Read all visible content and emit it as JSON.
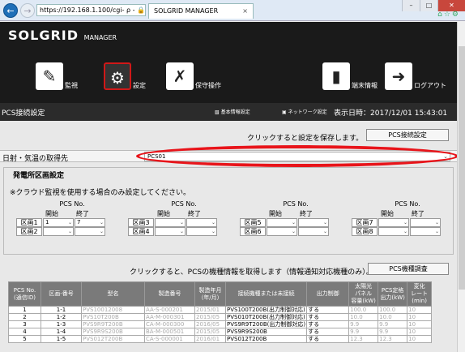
{
  "browser": {
    "url": "https://192.168.1.100/cgi- ρ - 🔒 C",
    "tab_title": "SOLGRID MANAGER",
    "tab_close": "×",
    "controls": {
      "min": "–",
      "max": "□",
      "close": "✕"
    }
  },
  "header": {
    "logo": "SOLGRID",
    "logo_sub": "MANAGER",
    "nav": {
      "monitor": "監視",
      "settings": "設定",
      "maintenance": "保守操作",
      "terminal_info": "端末情報",
      "logout": "ログアウト"
    }
  },
  "subheader": {
    "page_title": "PCS接続設定",
    "basic_settings": "基本情報設定",
    "network_settings": "ネットワーク設定",
    "datetime_label": "表示日時：2017/12/01 15:43:01"
  },
  "save": {
    "note": "クリックすると設定を保存します。",
    "button": "PCS接続設定"
  },
  "source": {
    "label": "日射・気温の取得先",
    "value": "PCS01"
  },
  "area": {
    "title": "発電所区画設定",
    "note": "※クラウド監視を使用する場合のみ設定してください。",
    "pcs_no": "PCS No.",
    "start": "開始",
    "end": "終了",
    "groups": [
      {
        "rows": [
          {
            "label": "区画1",
            "start": "1",
            "end": "7"
          },
          {
            "label": "区画2",
            "start": "",
            "end": ""
          }
        ]
      },
      {
        "rows": [
          {
            "label": "区画3",
            "start": "",
            "end": ""
          },
          {
            "label": "区画4",
            "start": "",
            "end": ""
          }
        ]
      },
      {
        "rows": [
          {
            "label": "区画5",
            "start": "",
            "end": ""
          },
          {
            "label": "区画6",
            "start": "",
            "end": ""
          }
        ]
      },
      {
        "rows": [
          {
            "label": "区画7",
            "start": "",
            "end": ""
          },
          {
            "label": "区画8",
            "start": "",
            "end": ""
          }
        ]
      }
    ]
  },
  "model": {
    "note": "クリックすると、PCSの機種情報を取得します（情報通知対応機種のみ）。",
    "button": "PCS機種調査"
  },
  "table": {
    "headers": [
      "PCS No.\n(通信ID)",
      "区画-番号",
      "型名",
      "製造番号",
      "製造年月\n（年/月）",
      "接続機種または未接続",
      "出力制御",
      "太陽光\nパネル\n容量(kW)",
      "PCS定格\n出力(kW)",
      "変化\nレート\n(min)"
    ],
    "rows": [
      {
        "no": "1",
        "area": "1-1",
        "model": "PVS10012008",
        "serial": "AA-S-000201",
        "ym": "2015/01",
        "conn": "PVS100T200B(出力制御対応)",
        "ctrl": "する",
        "panel": "100.0",
        "rated": "100.0",
        "rate": "10"
      },
      {
        "no": "2",
        "area": "1-2",
        "model": "PVS10T200B",
        "serial": "AA-M-000301",
        "ym": "2015/05",
        "conn": "PVS010T200B(出力制御対応)",
        "ctrl": "する",
        "panel": "10.0",
        "rated": "10.0",
        "rate": "10"
      },
      {
        "no": "3",
        "area": "1-3",
        "model": "PVS9R9T200B",
        "serial": "CA-M-000300",
        "ym": "2016/05",
        "conn": "PVS9R9T200B(出力制御対応)",
        "ctrl": "する",
        "panel": "9.9",
        "rated": "9.9",
        "rate": "10"
      },
      {
        "no": "4",
        "area": "1-4",
        "model": "PVS9R9S200B",
        "serial": "BA-M-000501",
        "ym": "2015/05",
        "conn": "PVS9R9S200B",
        "ctrl": "する",
        "panel": "9.9",
        "rated": "9.9",
        "rate": "10"
      },
      {
        "no": "5",
        "area": "1-5",
        "model": "PVS012T200B",
        "serial": "CA-S-000001",
        "ym": "2016/01",
        "conn": "PVS012T200B",
        "ctrl": "する",
        "panel": "12.3",
        "rated": "12.3",
        "rate": "10"
      }
    ]
  }
}
